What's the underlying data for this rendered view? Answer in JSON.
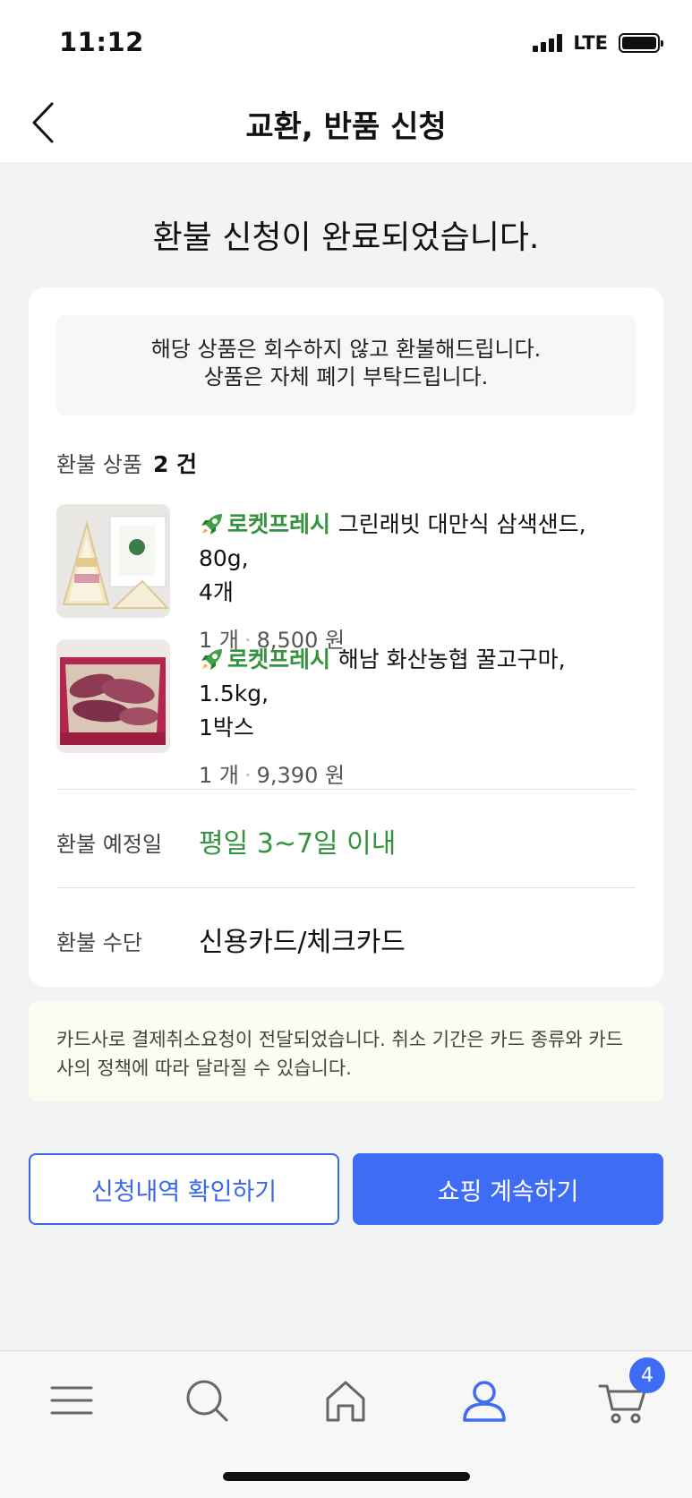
{
  "status_bar": {
    "time": "11:12",
    "network": "LTE"
  },
  "header": {
    "title": "교환, 반품 신청",
    "back_icon": "chevron-left-icon"
  },
  "headline": "환불 신청이 완료되었습니다.",
  "notice": {
    "line1": "해당 상품은 회수하지 않고 환불해드립니다.",
    "line2": "상품은 자체 폐기 부탁드립니다."
  },
  "refund_items": {
    "label": "환불 상품",
    "count": "2 건"
  },
  "products": [
    {
      "badge": "로켓프레시",
      "name": "그린래빗 대만식 삼색샌드, 80g,",
      "name_line2": "4개",
      "qty": "1 개",
      "price": "8,500 원"
    },
    {
      "badge": "로켓프레시",
      "name": "해남 화산농협 꿀고구마, 1.5kg,",
      "name_line2": "1박스",
      "qty": "1 개",
      "price": "9,390 원"
    }
  ],
  "refund_date": {
    "label": "환불 예정일",
    "value": "평일 3~7일 이내"
  },
  "refund_method": {
    "label": "환불 수단",
    "value": "신용카드/체크카드"
  },
  "card_notice": {
    "line1": "카드사로 결제취소요청이 전달되었습니다. 취소 기간은 카드 종류와 카드",
    "line2": "사의 정책에 따라 달라질 수 있습니다."
  },
  "buttons": {
    "history": "신청내역 확인하기",
    "continue": "쇼핑 계속하기"
  },
  "tab_bar": {
    "items": [
      "menu-icon",
      "search-icon",
      "home-icon",
      "user-icon",
      "cart-icon"
    ],
    "cart_count": "4"
  },
  "colors": {
    "accent": "#3f6cf4",
    "green": "#34943d"
  }
}
